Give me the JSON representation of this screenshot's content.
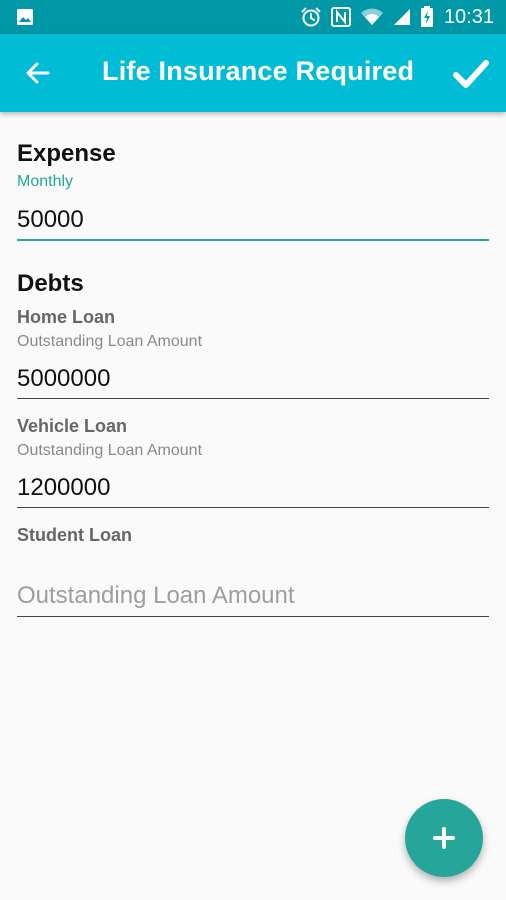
{
  "status_bar": {
    "time": "10:31",
    "icons": [
      "image-icon",
      "alarm-icon",
      "nfc-icon",
      "wifi-icon",
      "signal-icon",
      "battery-charging-icon"
    ]
  },
  "app_bar": {
    "title": "Life Insurance Required",
    "back_icon": "arrow-back-icon",
    "confirm_icon": "check-icon",
    "color": "#00bcd4"
  },
  "expense": {
    "title": "Expense",
    "subtitle": "Monthly",
    "value": "50000"
  },
  "debts": {
    "title": "Debts",
    "items": [
      {
        "label": "Home Loan",
        "sublabel": "Outstanding Loan Amount",
        "value": "5000000",
        "placeholder": ""
      },
      {
        "label": "Vehicle Loan",
        "sublabel": "Outstanding Loan Amount",
        "value": "1200000",
        "placeholder": ""
      },
      {
        "label": "Student Loan",
        "sublabel": "",
        "value": "",
        "placeholder": "Outstanding Loan Amount"
      }
    ]
  },
  "fab": {
    "icon": "plus-icon",
    "color": "#26a69a"
  },
  "colors": {
    "status_bar": "#0097a7",
    "accent": "#26a69a"
  }
}
